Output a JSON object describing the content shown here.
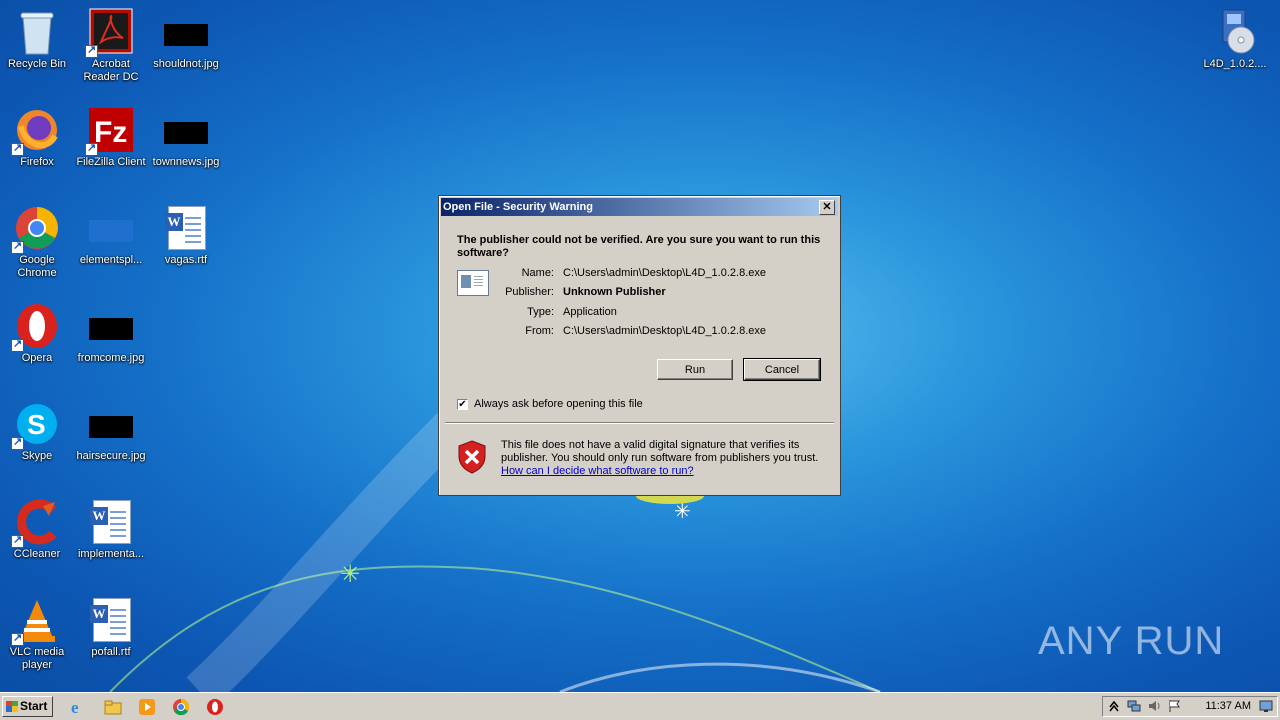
{
  "desktop_icons": [
    {
      "label": "Recycle Bin",
      "icon": "recycle-bin-icon"
    },
    {
      "label": "Acrobat Reader DC",
      "icon": "acrobat-reader-icon"
    },
    {
      "label": "shouldnot.jpg",
      "icon": "image-file-icon"
    },
    {
      "label": "Firefox",
      "icon": "firefox-icon"
    },
    {
      "label": "FileZilla Client",
      "icon": "filezilla-icon"
    },
    {
      "label": "townnews.jpg",
      "icon": "image-file-icon"
    },
    {
      "label": "Google Chrome",
      "icon": "chrome-icon"
    },
    {
      "label": "elementspl...",
      "icon": "image-file-icon"
    },
    {
      "label": "vagas.rtf",
      "icon": "word-document-icon"
    },
    {
      "label": "Opera",
      "icon": "opera-icon"
    },
    {
      "label": "fromcome.jpg",
      "icon": "image-file-icon"
    },
    {
      "label": "Skype",
      "icon": "skype-icon"
    },
    {
      "label": "hairsecure.jpg",
      "icon": "image-file-icon"
    },
    {
      "label": "CCleaner",
      "icon": "ccleaner-icon"
    },
    {
      "label": "implementa...",
      "icon": "word-document-icon"
    },
    {
      "label": "VLC media player",
      "icon": "vlc-icon"
    },
    {
      "label": "pofall.rtf",
      "icon": "word-document-icon"
    },
    {
      "label": "L4D_1.0.2....",
      "icon": "installer-icon"
    }
  ],
  "dialog": {
    "title": "Open File - Security Warning",
    "question": "The publisher could not be verified.  Are you sure you want to run this software?",
    "fields": [
      {
        "key": "Name:",
        "value": "C:\\Users\\admin\\Desktop\\L4D_1.0.2.8.exe"
      },
      {
        "key": "Publisher:",
        "value": "Unknown Publisher"
      },
      {
        "key": "Type:",
        "value": "Application"
      },
      {
        "key": "From:",
        "value": "C:\\Users\\admin\\Desktop\\L4D_1.0.2.8.exe"
      }
    ],
    "run_label": "Run",
    "cancel_label": "Cancel",
    "checkbox_label": "Always ask before opening this file",
    "checkbox_checked": true,
    "warning_text": "This file does not have a valid digital signature that verifies its publisher.  You should only run software from publishers you trust.",
    "warning_link": "How can I decide what software to run?"
  },
  "taskbar": {
    "start_label": "Start",
    "quick_launch": [
      "internet-explorer-icon",
      "folder-icon",
      "media-player-icon",
      "chrome-icon",
      "opera-icon"
    ],
    "tray_icons": [
      "show-hidden-icons-icon",
      "network-icon",
      "volume-icon",
      "flag-icon",
      "show-desktop-icon"
    ],
    "clock": "11:37 AM"
  },
  "watermark": "ANY RUN"
}
